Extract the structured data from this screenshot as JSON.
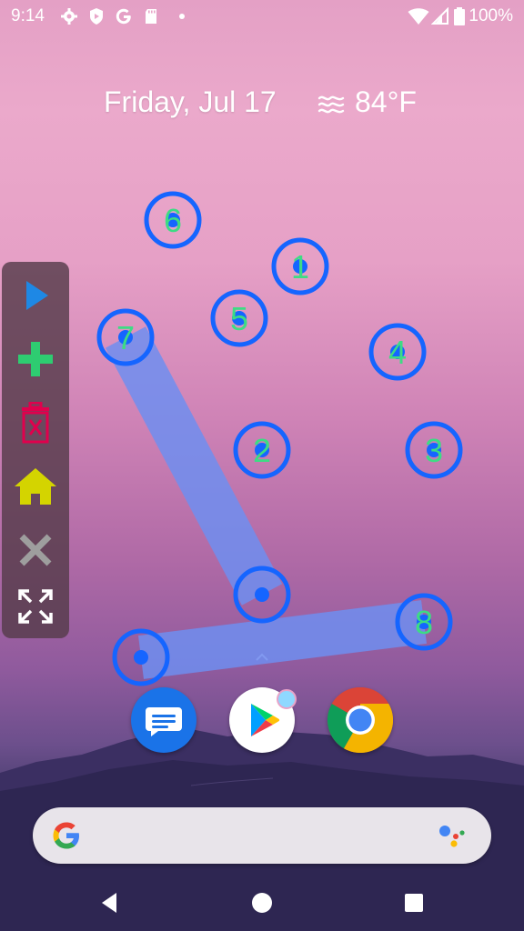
{
  "status_bar": {
    "time": "9:14",
    "battery_percent": "100%",
    "left_icons": [
      "settings-icon",
      "shield-icon",
      "google-g-icon",
      "sd-card-icon",
      "dot-icon"
    ],
    "right_icons": [
      "wifi-icon",
      "signal-icon",
      "battery-icon"
    ]
  },
  "home": {
    "date": "Friday, Jul 17",
    "temperature": "84°F",
    "weather_icon": "haze-icon"
  },
  "toolbar": {
    "buttons": [
      "play-icon",
      "add-icon",
      "delete-icon",
      "home-icon",
      "close-icon",
      "expand-icon"
    ],
    "colors": {
      "play": "#1e88e5",
      "add": "#2ecc71",
      "delete": "#e0004d",
      "home": "#d4d400",
      "close": "#9e9e9e",
      "expand": "#ffffff"
    }
  },
  "gesture_overlay": {
    "tap_points": [
      {
        "label": "1"
      },
      {
        "label": "2"
      },
      {
        "label": "3"
      },
      {
        "label": "4"
      },
      {
        "label": "5"
      },
      {
        "label": "6"
      },
      {
        "label": "7"
      },
      {
        "label": "8"
      }
    ],
    "ring_color": "#1565ff",
    "label_color": "#3ddc84",
    "swipe_color": "#6f8ef0"
  },
  "dock": {
    "apps": [
      "messages-icon",
      "play-store-icon",
      "chrome-icon"
    ]
  },
  "search": {
    "logo": "google-g-icon",
    "assistant_icon": "assistant-icon"
  },
  "nav": {
    "buttons": [
      "back-icon",
      "home-button-icon",
      "recents-icon"
    ]
  }
}
